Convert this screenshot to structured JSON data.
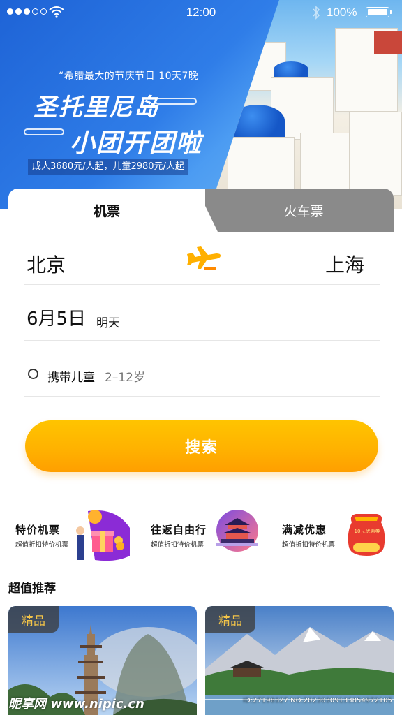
{
  "status_bar": {
    "time": "12:00",
    "battery": "100%"
  },
  "banner": {
    "subtitle": "“希腊最大的节庆节日 10天7晚",
    "title_line1": "圣托里尼岛",
    "title_line2": "小团开团啦",
    "price": "成人3680元/人起，儿童2980元/人起"
  },
  "tabs": [
    {
      "label": "机票",
      "active": true
    },
    {
      "label": "火车票",
      "active": false
    }
  ],
  "route": {
    "from": "北京",
    "to": "上海"
  },
  "date": {
    "value": "6月5日",
    "day_label": "明天"
  },
  "child_option": {
    "label": "携带儿童",
    "age_range": "2–12岁",
    "checked": false
  },
  "search_button": "搜索",
  "features": [
    {
      "title": "特价机票",
      "subtitle": "超值折扣特价机票",
      "icon": "gift-box-icon"
    },
    {
      "title": "往返自由行",
      "subtitle": "超值折扣特价机票",
      "icon": "temple-icon"
    },
    {
      "title": "满减优惠",
      "subtitle": "超值折扣特价机票",
      "icon": "red-envelope-icon"
    }
  ],
  "coupon_text": "10元优惠券",
  "recommend": {
    "title": "超值推荐",
    "cards": [
      {
        "tag": "精品",
        "image": "pagoda-photo"
      },
      {
        "tag": "精品",
        "image": "lake-mountain-photo"
      }
    ]
  },
  "watermark": {
    "site": "昵享网 www.nipic.cn",
    "id": "ID:27198327 NO:20230309133854972105"
  },
  "colors": {
    "accent_yellow": "#ffb200",
    "banner_blue": "#1e63d6",
    "tab_gray": "#8a8a8a",
    "tag_gold": "#f3c448"
  }
}
